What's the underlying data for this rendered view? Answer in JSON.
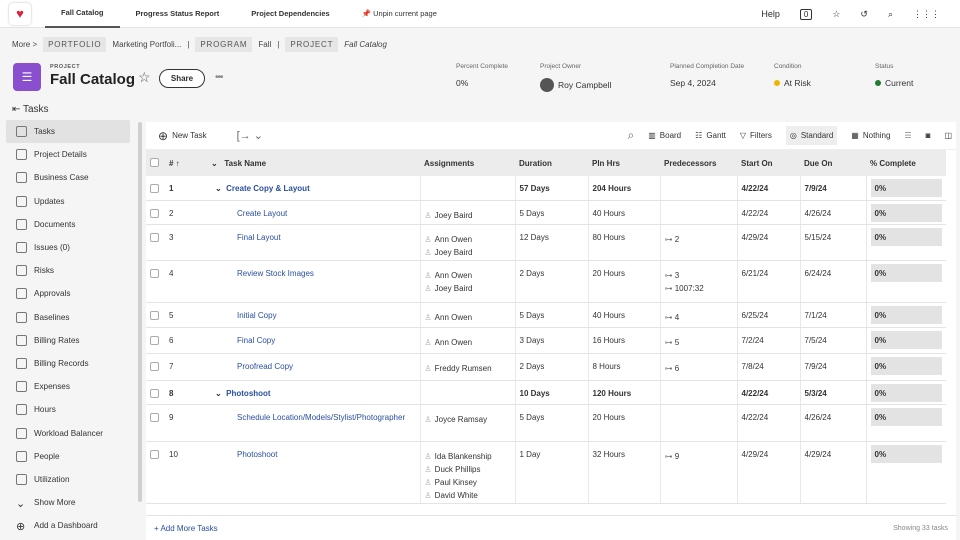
{
  "topbar": {
    "tabs": [
      "Fall Catalog",
      "Progress Status Report",
      "Project Dependencies"
    ],
    "unpin": "Unpin current page",
    "help": "Help",
    "notifications": "0"
  },
  "breadcrumb": {
    "more": "More >",
    "portfolio_label": "PORTFOLIO",
    "portfolio": "Marketing Portfoli...",
    "program_label": "PROGRAM",
    "program": "Fall",
    "project_label": "PROJECT",
    "project": "Fall Catalog"
  },
  "project": {
    "label": "PROJECT",
    "title": "Fall Catalog",
    "share": "Share",
    "meta": [
      {
        "key": "Percent Complete",
        "value": "0%"
      },
      {
        "key": "Project Owner",
        "value": "Roy Campbell"
      },
      {
        "key": "Planned Completion Date",
        "value": "Sep 4, 2024"
      },
      {
        "key": "Condition",
        "value": "At Risk",
        "color": "#f0b400"
      },
      {
        "key": "Status",
        "value": "Current",
        "color": "#1e7d32"
      }
    ]
  },
  "tasks_header": "Tasks",
  "sidebar": [
    "Tasks",
    "Project Details",
    "Business Case",
    "Updates",
    "Documents",
    "Issues (0)",
    "Risks",
    "Approvals",
    "Baselines",
    "Billing Rates",
    "Billing Records",
    "Expenses",
    "Hours",
    "Workload Balancer",
    "People",
    "Utilization",
    "Show More",
    "Add a Dashboard"
  ],
  "toolbar": {
    "new_task": "New Task",
    "board": "Board",
    "gantt": "Gantt",
    "filters": "Filters",
    "standard": "Standard",
    "nothing": "Nothing"
  },
  "columns": [
    "# ↑",
    "Task Name",
    "Assignments",
    "Duration",
    "Pln Hrs",
    "Predecessors",
    "Start On",
    "Due On",
    "% Complete"
  ],
  "rows": [
    {
      "num": "1",
      "name": "Create Copy & Layout",
      "parent": true,
      "assign": [],
      "duration": "57 Days",
      "hours": "204 Hours",
      "pred": [],
      "start": "4/22/24",
      "due": "7/9/24",
      "pct": "0%"
    },
    {
      "num": "2",
      "name": "Create Layout",
      "assign": [
        "Joey Baird"
      ],
      "duration": "5 Days",
      "hours": "40 Hours",
      "pred": [],
      "start": "4/22/24",
      "due": "4/26/24",
      "pct": "0%"
    },
    {
      "num": "3",
      "name": "Final Layout",
      "assign": [
        "Ann Owen",
        "Joey Baird"
      ],
      "duration": "12 Days",
      "hours": "80 Hours",
      "pred": [
        "2"
      ],
      "start": "4/29/24",
      "due": "5/15/24",
      "pct": "0%"
    },
    {
      "num": "4",
      "name": "Review Stock Images",
      "assign": [
        "Ann Owen",
        "Joey Baird"
      ],
      "duration": "2 Days",
      "hours": "20 Hours",
      "pred": [
        "3",
        "1007:32"
      ],
      "start": "6/21/24",
      "due": "6/24/24",
      "pct": "0%"
    },
    {
      "num": "5",
      "name": "Initial Copy",
      "assign": [
        "Ann Owen"
      ],
      "duration": "5 Days",
      "hours": "40 Hours",
      "pred": [
        "4"
      ],
      "start": "6/25/24",
      "due": "7/1/24",
      "pct": "0%"
    },
    {
      "num": "6",
      "name": "Final Copy",
      "assign": [
        "Ann Owen"
      ],
      "duration": "3 Days",
      "hours": "16 Hours",
      "pred": [
        "5"
      ],
      "start": "7/2/24",
      "due": "7/5/24",
      "pct": "0%"
    },
    {
      "num": "7",
      "name": "Proofread Copy",
      "assign": [
        "Freddy Rumsen"
      ],
      "duration": "2 Days",
      "hours": "8 Hours",
      "pred": [
        "6"
      ],
      "start": "7/8/24",
      "due": "7/9/24",
      "pct": "0%"
    },
    {
      "num": "8",
      "name": "Photoshoot",
      "parent": true,
      "assign": [],
      "duration": "10 Days",
      "hours": "120 Hours",
      "pred": [],
      "start": "4/22/24",
      "due": "5/3/24",
      "pct": "0%"
    },
    {
      "num": "9",
      "name": "Schedule Location/Models/Stylist/Photographer",
      "assign": [
        "Joyce Ramsay"
      ],
      "duration": "5 Days",
      "hours": "20 Hours",
      "pred": [],
      "start": "4/22/24",
      "due": "4/26/24",
      "pct": "0%"
    },
    {
      "num": "10",
      "name": "Photoshoot",
      "assign": [
        "Ida Blankenship",
        "Duck Phillips",
        "Paul Kinsey",
        "David White"
      ],
      "duration": "1 Day",
      "hours": "32 Hours",
      "pred": [
        "9"
      ],
      "start": "4/29/24",
      "due": "4/29/24",
      "pct": "0%"
    }
  ],
  "footer": {
    "add": "+ Add More Tasks",
    "showing": "Showing 33 tasks"
  }
}
